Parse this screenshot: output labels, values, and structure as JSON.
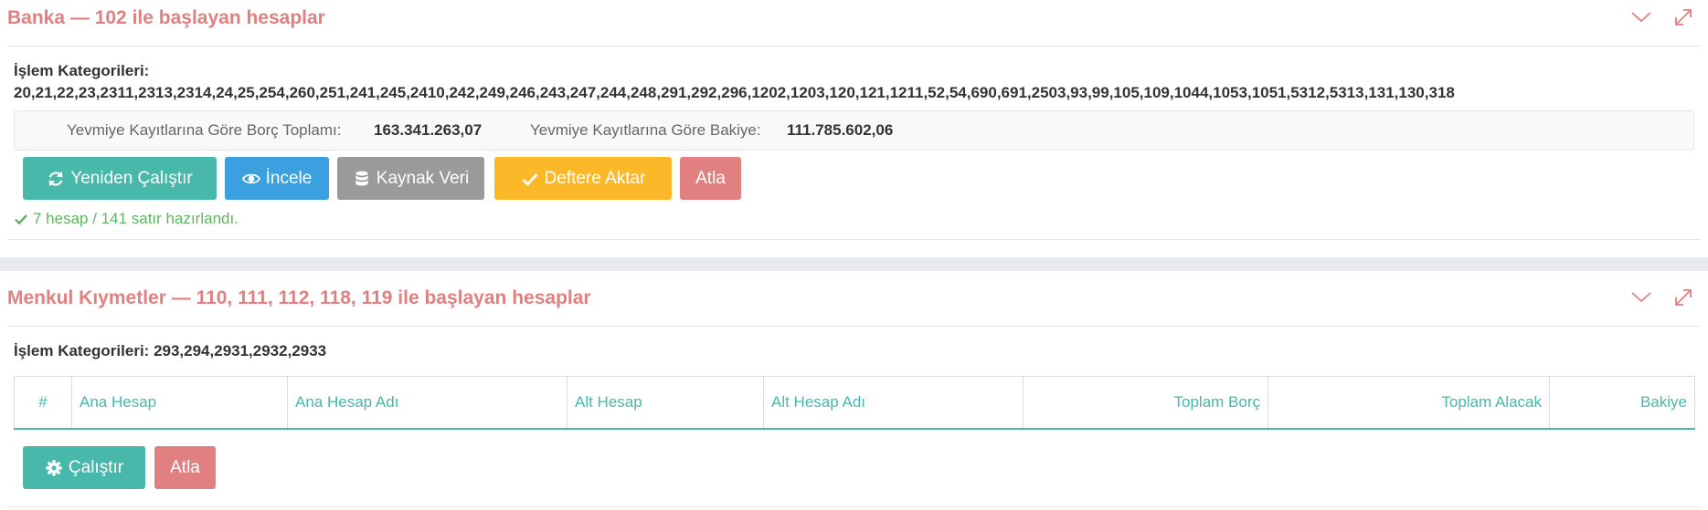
{
  "panel1": {
    "title": "Banka — 102 ile başlayan hesaplar",
    "categories_label": "İşlem Kategorileri:",
    "categories_value": "20,21,22,23,2311,2313,2314,24,25,254,260,251,241,245,2410,242,249,246,243,247,244,248,291,292,296,1202,1203,120,121,1211,52,54,690,691,2503,93,99,105,109,1044,1053,1051,5312,5313,131,130,318",
    "summary": {
      "debit_label": "Yevmiye Kayıtlarına Göre Borç Toplamı:",
      "debit_value": "163.341.263,07",
      "balance_label": "Yevmiye Kayıtlarına Göre Bakiye:",
      "balance_value": "111.785.602,06"
    },
    "buttons": {
      "rerun": "Yeniden Çalıştır",
      "inspect": "İncele",
      "source": "Kaynak Veri",
      "transfer": "Deftere Aktar",
      "skip": "Atla"
    },
    "status": "7 hesap / 141 satır hazırlandı."
  },
  "panel2": {
    "title": "Menkul Kıymetler — 110, 111, 112, 118, 119 ile başlayan hesaplar",
    "categories_label": "İşlem Kategorileri:",
    "categories_value": "293,294,2931,2932,2933",
    "table": {
      "columns": [
        "#",
        "Ana Hesap",
        "Ana Hesap Adı",
        "Alt Hesap",
        "Alt Hesap Adı",
        "Toplam Borç",
        "Toplam Alacak",
        "Bakiye"
      ]
    },
    "buttons": {
      "run": "Çalıştır",
      "skip": "Atla"
    }
  },
  "icons": {
    "collapse": "chevron-down-icon",
    "expand": "expand-icon",
    "rerun": "refresh-icon",
    "inspect": "eye-icon",
    "source": "database-icon",
    "transfer": "check-icon",
    "run": "gear-icon",
    "status": "check-icon"
  },
  "colors": {
    "title": "#e08080",
    "teal": "#47b8aa",
    "blue": "#3aa0df",
    "grey": "#9a9a9a",
    "amber": "#fbb829",
    "red": "#e08080",
    "success": "#5cb85c"
  }
}
